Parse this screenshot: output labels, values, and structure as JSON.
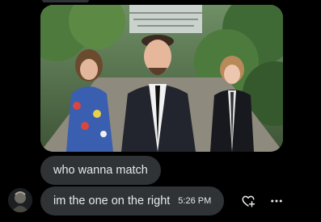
{
  "thread": {
    "messages": [
      {
        "text": "who wanna match"
      },
      {
        "text": "im the one on the right",
        "time": "5:26 PM"
      }
    ]
  },
  "icons": {
    "avatar": "avatar-image",
    "react": "heart-plus-icon",
    "more": "more-horizontal-icon"
  },
  "colors": {
    "background": "#000000",
    "bubble": "#2f3336",
    "text": "#e7e9ea"
  }
}
